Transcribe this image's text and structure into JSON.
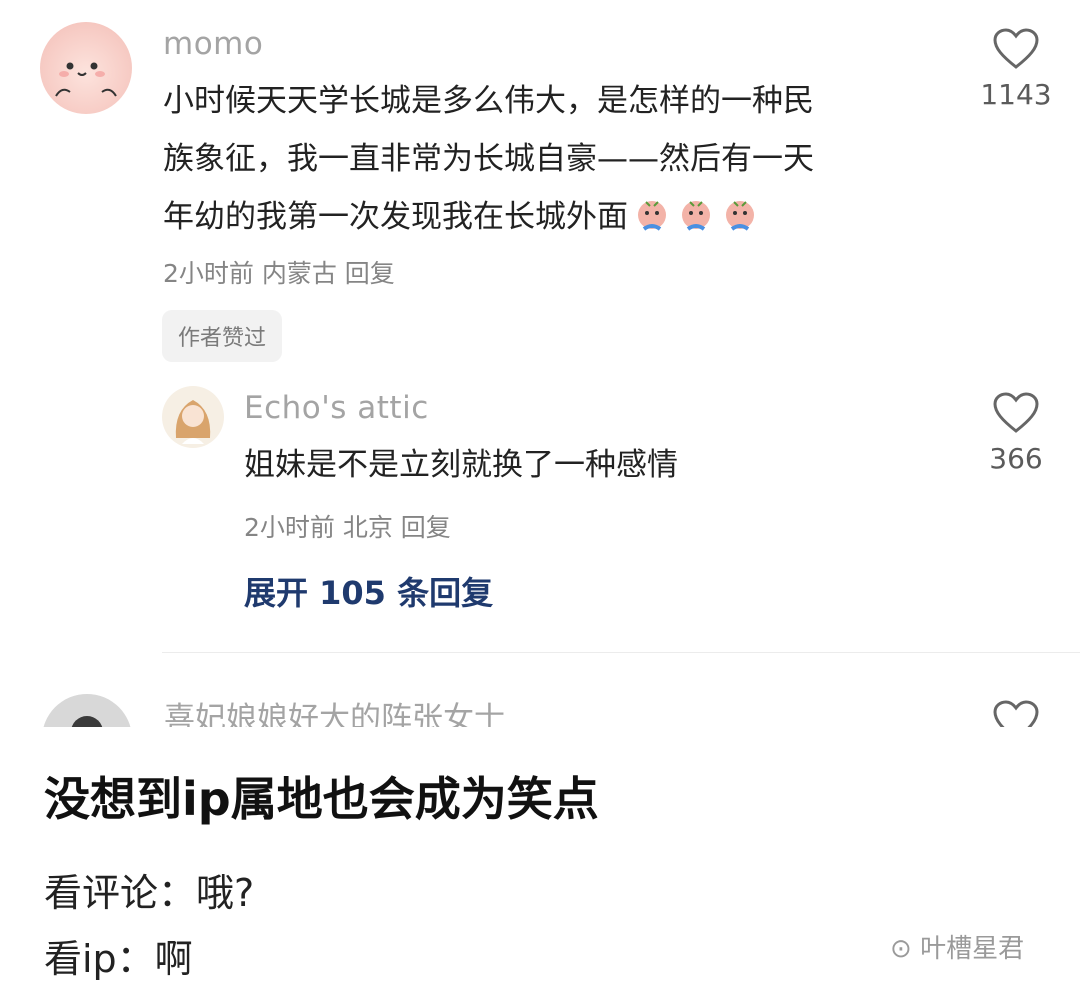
{
  "comments": [
    {
      "username": "momo",
      "lines": [
        "小时候天天学长城是多么伟大，是怎样的一种民",
        "族象征，我一直非常为长城自豪——然后有一天",
        "年幼的我第一次发现我在长城外面"
      ],
      "emoji": [
        "crying-emoji",
        "crying-emoji",
        "crying-emoji"
      ],
      "meta": "2小时前 内蒙古 回复",
      "likes": "1143",
      "badge": "作者赞过",
      "reply": {
        "username": "Echo's attic",
        "text": "姐妹是不是立刻就换了一种感情",
        "meta": "2小时前 北京 回复",
        "likes": "366"
      },
      "expand_label": "展开 105 条回复"
    },
    {
      "username": "喜妃娘娘好大的阵张女士"
    }
  ],
  "article": {
    "title": "没想到ip属地也会成为笑点",
    "line1": "看评论：哦?",
    "line2": "看ip：啊",
    "watermark": "叶槽星君"
  },
  "colors": {
    "expand_link": "#1f3a6e",
    "username": "#a4a4a4",
    "meta": "#858585"
  }
}
